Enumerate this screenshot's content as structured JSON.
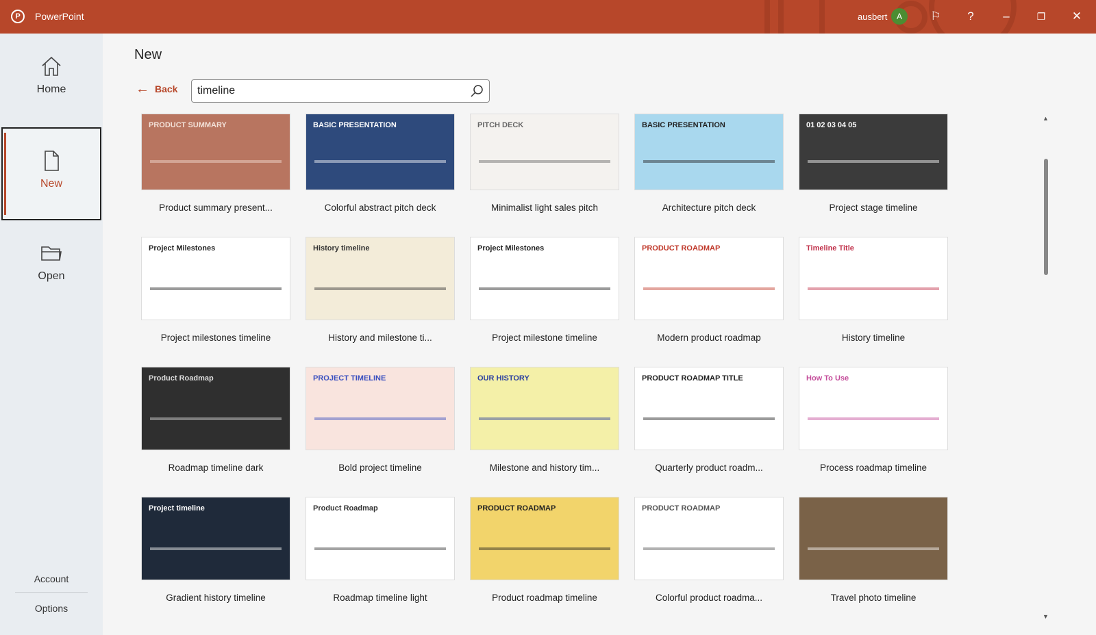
{
  "titlebar": {
    "app": "PowerPoint",
    "user": "ausbert",
    "avatar_initial": "A",
    "brand_color": "#b7472a"
  },
  "sidebar": {
    "items": [
      {
        "label": "Home",
        "icon": "home-icon"
      },
      {
        "label": "New",
        "icon": "document-icon",
        "active": true
      },
      {
        "label": "Open",
        "icon": "folder-icon"
      }
    ],
    "account": "Account",
    "options": "Options"
  },
  "main": {
    "title": "New",
    "back": "Back",
    "search": {
      "value": "timeline"
    }
  },
  "templates": [
    {
      "label": "Product summary present...",
      "thumb_text": "PRODUCT SUMMARY",
      "bg": "#b87560",
      "fg": "#f3e1d8"
    },
    {
      "label": "Colorful abstract pitch deck",
      "thumb_text": "BASIC PRESENTATION",
      "bg": "#2e4a7c",
      "fg": "#ffffff"
    },
    {
      "label": "Minimalist light sales pitch",
      "thumb_text": "PITCH DECK",
      "bg": "#f4f2ef",
      "fg": "#666666"
    },
    {
      "label": "Architecture pitch deck",
      "thumb_text": "BASIC PRESENTATION",
      "bg": "#a9d8ee",
      "fg": "#222222"
    },
    {
      "label": "Project stage timeline",
      "thumb_text": "01 02 03 04 05",
      "bg": "#3b3b3b",
      "fg": "#ffffff"
    },
    {
      "label": "Project milestones timeline",
      "thumb_text": "Project Milestones",
      "bg": "#ffffff",
      "fg": "#222222"
    },
    {
      "label": "History and milestone ti...",
      "thumb_text": "History timeline",
      "bg": "#f3ecd9",
      "fg": "#333333"
    },
    {
      "label": "Project milestone timeline",
      "thumb_text": "Project Milestones",
      "bg": "#ffffff",
      "fg": "#222222"
    },
    {
      "label": "Modern product roadmap",
      "thumb_text": "PRODUCT ROADMAP",
      "bg": "#ffffff",
      "fg": "#c0392b"
    },
    {
      "label": "History timeline",
      "thumb_text": "Timeline Title",
      "bg": "#ffffff",
      "fg": "#c0304a"
    },
    {
      "label": "Roadmap timeline dark",
      "thumb_text": "Product Roadmap",
      "bg": "#2f2f2f",
      "fg": "#dddddd"
    },
    {
      "label": "Bold project timeline",
      "thumb_text": "PROJECT TIMELINE",
      "bg": "#f9e4de",
      "fg": "#3a4fbf"
    },
    {
      "label": "Milestone and history tim...",
      "thumb_text": "OUR HISTORY",
      "bg": "#f4f0a8",
      "fg": "#2a3fa0"
    },
    {
      "label": "Quarterly product roadm...",
      "thumb_text": "PRODUCT ROADMAP TITLE",
      "bg": "#ffffff",
      "fg": "#222222"
    },
    {
      "label": "Process roadmap timeline",
      "thumb_text": "How To Use",
      "bg": "#ffffff",
      "fg": "#c44c9a"
    },
    {
      "label": "Gradient history timeline",
      "thumb_text": "Project timeline",
      "bg": "#1f2a3a",
      "fg": "#ffffff"
    },
    {
      "label": "Roadmap timeline light",
      "thumb_text": "Product Roadmap",
      "bg": "#ffffff",
      "fg": "#333333"
    },
    {
      "label": "Product roadmap timeline",
      "thumb_text": "PRODUCT ROADMAP",
      "bg": "#f2d46b",
      "fg": "#222222"
    },
    {
      "label": "Colorful product roadma...",
      "thumb_text": "PRODUCT ROADMAP",
      "bg": "#ffffff",
      "fg": "#555555"
    },
    {
      "label": "Travel photo timeline",
      "thumb_text": "",
      "bg": "#7a6248",
      "fg": "#ffffff"
    }
  ]
}
